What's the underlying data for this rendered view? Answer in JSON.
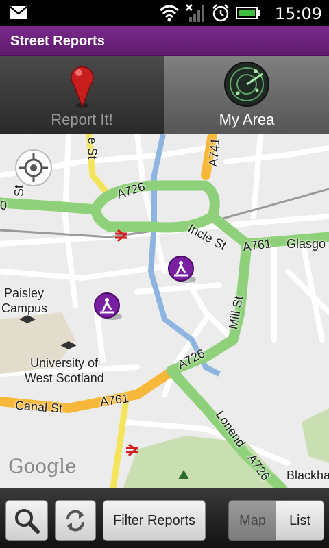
{
  "status_bar": {
    "time": "15:09",
    "icons": [
      "envelope-icon",
      "wifi-icon",
      "signal-icon",
      "alarm-icon",
      "battery-icon"
    ]
  },
  "app": {
    "title": "Street Reports",
    "accent_color": "#6a1f7c"
  },
  "tabs": [
    {
      "label": "Report It!",
      "icon": "map-pin-icon",
      "selected": false
    },
    {
      "label": "My Area",
      "icon": "radar-icon",
      "selected": true
    }
  ],
  "map": {
    "labels": {
      "a726_top": "A726",
      "a741": "A741",
      "incle_st": "Incle St",
      "a761_right": "A761",
      "glasgow": "Glasgo",
      "paisley_campus_1": "Paisley",
      "paisley_campus_2": "Campus",
      "mill_st": "Mill St",
      "university_1": "University of",
      "university_2": "West Scotland",
      "a726_mid": "A726",
      "canal_st": "Canal St",
      "a761_bottom": "A761",
      "lonend": "Lonend",
      "a726_bottom": "A726",
      "blackhall": "Blackha",
      "st_top_left": "St",
      "st_top_center": "e St",
      "left_zero": "0"
    },
    "logo": "Google",
    "report_pins": 2
  },
  "toolbar": {
    "filter_label": "Filter Reports",
    "map_label": "Map",
    "list_label": "List",
    "selected": "Map"
  }
}
